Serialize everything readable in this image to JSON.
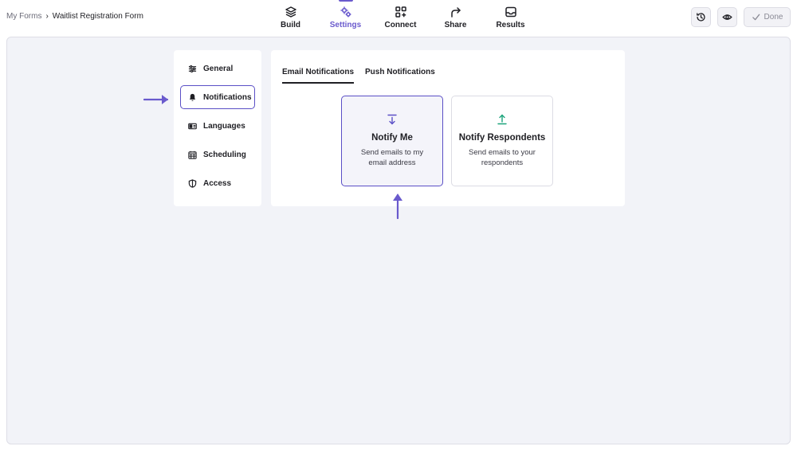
{
  "breadcrumb": {
    "root": "My Forms",
    "separator": "›",
    "current": "Waitlist Registration Form"
  },
  "nav": [
    {
      "label": "Build",
      "icon": "layers-icon"
    },
    {
      "label": "Settings",
      "icon": "gears-icon",
      "active": true
    },
    {
      "label": "Connect",
      "icon": "apps-plus-icon"
    },
    {
      "label": "Share",
      "icon": "share-arrow-icon"
    },
    {
      "label": "Results",
      "icon": "inbox-icon"
    }
  ],
  "actions": {
    "done_label": "Done",
    "history_icon": "history-icon",
    "preview_icon": "eye-icon"
  },
  "sidebar": {
    "items": [
      {
        "label": "General",
        "icon": "sliders-icon"
      },
      {
        "label": "Notifications",
        "icon": "bell-icon",
        "active": true
      },
      {
        "label": "Languages",
        "icon": "language-icon"
      },
      {
        "label": "Scheduling",
        "icon": "calendar-icon"
      },
      {
        "label": "Access",
        "icon": "shield-icon"
      }
    ]
  },
  "tabs": [
    {
      "label": "Email Notifications",
      "active": true
    },
    {
      "label": "Push Notifications"
    }
  ],
  "cards": [
    {
      "title": "Notify Me",
      "desc": "Send emails to my email address",
      "icon": "download-arrow-icon",
      "selected": true
    },
    {
      "title": "Notify Respondents",
      "desc": "Send emails to your respondents",
      "icon": "upload-arrow-icon"
    }
  ],
  "colors": {
    "accent": "#6a5acd",
    "respondent_icon": "#1aa37a",
    "annotation_arrow": "#6a5acd"
  }
}
